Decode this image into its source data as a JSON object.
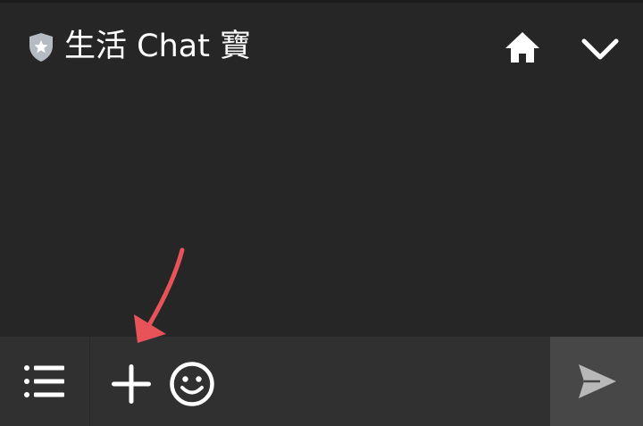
{
  "header": {
    "title": "生活 Chat 寶",
    "icons": {
      "badge": "shield-star-icon",
      "home": "home-icon",
      "collapse": "chevron-down-icon"
    }
  },
  "composer": {
    "icons": {
      "menu": "menu-list-icon",
      "attach": "plus-icon",
      "emoji": "smiley-icon",
      "send": "send-icon"
    },
    "message_value": "",
    "message_placeholder": ""
  },
  "colors": {
    "background": "#262626",
    "bottom_bar": "#303030",
    "send_area": "#474747",
    "icon": "#ffffff",
    "shield": "#b4bbc2",
    "annotation_arrow": "#e8535a"
  }
}
